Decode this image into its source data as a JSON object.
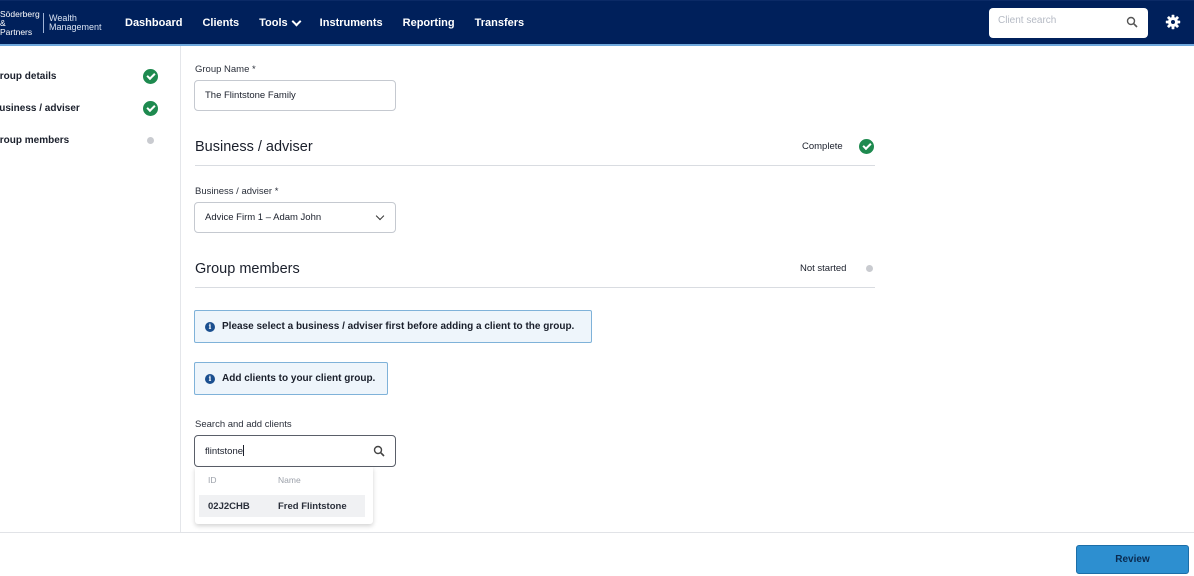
{
  "logo": {
    "left_text": "Söderberg & Partners",
    "right_text": "Wealth Management"
  },
  "nav": {
    "items": [
      {
        "label": "Dashboard"
      },
      {
        "label": "Clients"
      },
      {
        "label": "Tools",
        "has_dropdown": true
      },
      {
        "label": "Instruments"
      },
      {
        "label": "Reporting"
      },
      {
        "label": "Transfers"
      }
    ]
  },
  "header": {
    "client_search_placeholder": "Client search",
    "settings_icon": "gear-icon"
  },
  "sidebar": {
    "steps": [
      {
        "label": "Group details",
        "state": "complete"
      },
      {
        "label": "Business / adviser",
        "state": "complete"
      },
      {
        "label": "Group members",
        "state": "not-started"
      }
    ]
  },
  "form": {
    "group_name_label": "Group Name *",
    "group_name_value": "The Flintstone Family",
    "business_section": {
      "title": "Business / adviser",
      "status": "Complete"
    },
    "business_label": "Business / adviser *",
    "business_value": "Advice Firm 1 – Adam John",
    "members_section": {
      "title": "Group members",
      "status": "Not started"
    },
    "info_select_business": "Please select a business / adviser first before adding a client to the group.",
    "info_add_clients": "Add clients to your client group.",
    "search_label": "Search and add clients",
    "search_value": "flintstone"
  },
  "results": {
    "columns": [
      "ID",
      "Name"
    ],
    "rows": [
      {
        "id": "02J2CHB",
        "name": "Fred Flintstone"
      }
    ]
  },
  "footer": {
    "review_label": "Review"
  },
  "colors": {
    "nav_bg": "#00205b",
    "complete_green": "#1e8a4f",
    "info_border": "#7fb2d9",
    "review_button": "#2d8fd0"
  }
}
